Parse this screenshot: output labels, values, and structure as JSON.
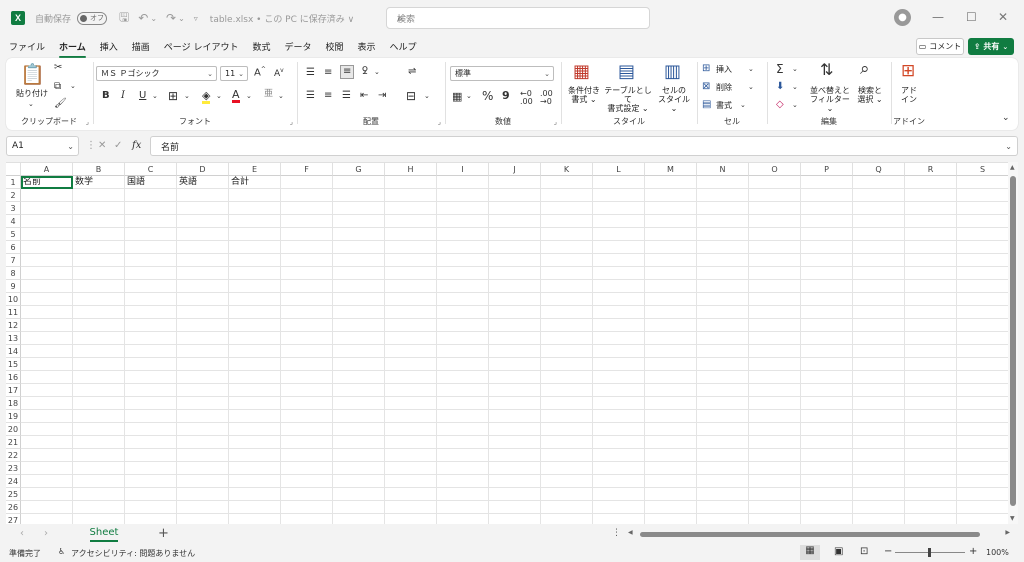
{
  "titlebar": {
    "app_icon": "X",
    "autosave_label": "自動保存",
    "autosave_state": "オフ",
    "document_title": "table.xlsx • この PC に保存済み ∨",
    "search_placeholder": "検索"
  },
  "tabs": [
    "ファイル",
    "ホーム",
    "挿入",
    "描画",
    "ページ レイアウト",
    "数式",
    "データ",
    "校閲",
    "表示",
    "ヘルプ"
  ],
  "active_tab": "ホーム",
  "header_buttons": {
    "comment": "コメント",
    "share": "共有"
  },
  "ribbon": {
    "clipboard": {
      "name": "クリップボード",
      "paste": "貼り付け"
    },
    "font": {
      "name": "フォント",
      "font_name": "ＭＳ Ｐゴシック",
      "font_size": "11",
      "grow": "A",
      "shrink": "A",
      "bold": "B",
      "italic": "I",
      "underline": "U"
    },
    "alignment": {
      "name": "配置"
    },
    "number": {
      "name": "数値",
      "format": "標準",
      "percent": "%",
      "comma": "9"
    },
    "styles": {
      "name": "スタイル",
      "conditional_1": "条件付き",
      "conditional_2": "書式",
      "table_1": "テーブルとして",
      "table_2": "書式設定",
      "cell_1": "セルの",
      "cell_2": "スタイル"
    },
    "cells": {
      "name": "セル",
      "insert": "挿入",
      "delete": "削除",
      "format": "書式"
    },
    "editing": {
      "name": "編集",
      "sort_1": "並べ替えと",
      "sort_2": "フィルター",
      "find_1": "検索と",
      "find_2": "選択"
    },
    "addins": {
      "name": "アドイン",
      "label_1": "アド",
      "label_2": "イン"
    }
  },
  "formula_bar": {
    "name_box": "A1",
    "formula": "名前",
    "fx": "fx"
  },
  "sheet": {
    "columns": [
      "A",
      "B",
      "C",
      "D",
      "E",
      "F",
      "G",
      "H",
      "I",
      "J",
      "K",
      "L",
      "M",
      "N",
      "O",
      "P",
      "Q",
      "R",
      "S"
    ],
    "rows": 27,
    "cells": [
      [
        "名前",
        "数学",
        "国語",
        "英語",
        "合計"
      ]
    ]
  },
  "sheet_tabs": [
    "Sheet"
  ],
  "status": {
    "ready": "準備完了",
    "accessibility": "アクセシビリティ: 問題ありません",
    "zoom": "100%",
    "zoom_minus": "−",
    "zoom_plus": "+"
  },
  "colors": {
    "accent": "#107c41",
    "background": "#f3f3f3"
  }
}
